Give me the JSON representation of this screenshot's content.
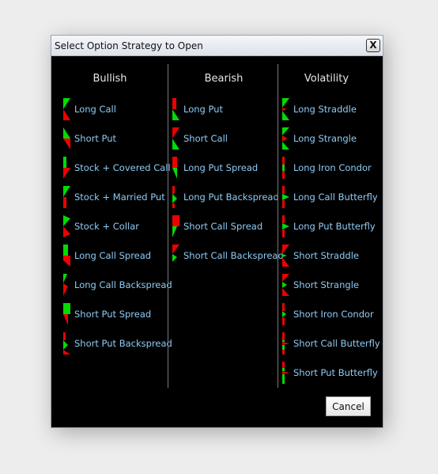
{
  "dialog": {
    "title": "Select Option Strategy to Open",
    "close_label": "X",
    "cancel_label": "Cancel"
  },
  "colors": {
    "gain": "#00dd00",
    "loss": "#ee0000",
    "label": "#8fcbf5",
    "background": "#000000"
  },
  "columns": [
    {
      "header": "Bullish",
      "items": [
        {
          "label": "Long Call",
          "icon": "long-call-payoff-icon"
        },
        {
          "label": "Short Put",
          "icon": "short-put-payoff-icon"
        },
        {
          "label": "Stock + Covered Call",
          "icon": "covered-call-payoff-icon"
        },
        {
          "label": "Stock + Married Put",
          "icon": "married-put-payoff-icon"
        },
        {
          "label": "Stock + Collar",
          "icon": "collar-payoff-icon"
        },
        {
          "label": "Long Call Spread",
          "icon": "long-call-spread-payoff-icon"
        },
        {
          "label": "Long Call Backspread",
          "icon": "long-call-backspread-payoff-icon"
        },
        {
          "label": "Short Put Spread",
          "icon": "short-put-spread-payoff-icon"
        },
        {
          "label": "Short Put Backspread",
          "icon": "short-put-backspread-payoff-icon"
        }
      ]
    },
    {
      "header": "Bearish",
      "items": [
        {
          "label": "Long Put",
          "icon": "long-put-payoff-icon"
        },
        {
          "label": "Short Call",
          "icon": "short-call-payoff-icon"
        },
        {
          "label": "Long Put Spread",
          "icon": "long-put-spread-payoff-icon"
        },
        {
          "label": "Long Put Backspread",
          "icon": "long-put-backspread-payoff-icon"
        },
        {
          "label": "Short Call Spread",
          "icon": "short-call-spread-payoff-icon"
        },
        {
          "label": "Short Call Backspread",
          "icon": "short-call-backspread-payoff-icon"
        }
      ]
    },
    {
      "header": "Volatility",
      "items": [
        {
          "label": "Long Straddle",
          "icon": "long-straddle-payoff-icon"
        },
        {
          "label": "Long Strangle",
          "icon": "long-strangle-payoff-icon"
        },
        {
          "label": "Long Iron Condor",
          "icon": "long-iron-condor-payoff-icon"
        },
        {
          "label": "Long Call Butterfly",
          "icon": "long-call-butterfly-payoff-icon"
        },
        {
          "label": "Long Put Butterfly",
          "icon": "long-put-butterfly-payoff-icon"
        },
        {
          "label": "Short Straddle",
          "icon": "short-straddle-payoff-icon"
        },
        {
          "label": "Short Strangle",
          "icon": "short-strangle-payoff-icon"
        },
        {
          "label": "Short Iron Condor",
          "icon": "short-iron-condor-payoff-icon"
        },
        {
          "label": "Short Call Butterfly",
          "icon": "short-call-butterfly-payoff-icon"
        },
        {
          "label": "Short Put Butterfly",
          "icon": "short-put-butterfly-payoff-icon"
        }
      ]
    }
  ]
}
